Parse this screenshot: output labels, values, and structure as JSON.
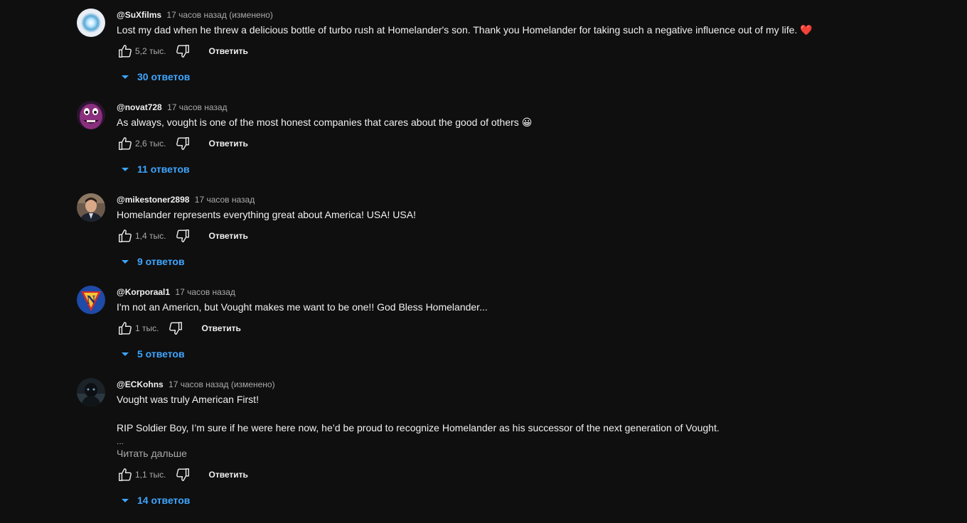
{
  "comments": [
    {
      "author": "@SuXfilms",
      "time": "17 часов назад",
      "edited": "(изменено)",
      "text": "Lost my dad when he threw a delicious bottle of turbo rush at Homelander's son. Thank you Homelander for taking such a negative influence out of my life.",
      "emoji": "❤️",
      "likes": "5,2 тыс.",
      "reply_label": "Ответить",
      "replies_label": "30 ответов",
      "avatar": "glowing-orb-avatar"
    },
    {
      "author": "@novat728",
      "time": "17 часов назад",
      "text": "As always, vought is one of the most honest companies that cares about the good of others",
      "emoji": "😀",
      "likes": "2,6 тыс.",
      "reply_label": "Ответить",
      "replies_label": "11 ответов",
      "avatar": "purple-character-avatar"
    },
    {
      "author": "@mikestoner2898",
      "time": "17 часов назад",
      "text": "Homelander represents everything great about America! USA! USA!",
      "likes": "1,4 тыс.",
      "reply_label": "Ответить",
      "replies_label": "9 ответов",
      "avatar": "man-in-suit-avatar"
    },
    {
      "author": "@Korporaal1",
      "time": "17 часов назад",
      "text": "I'm not an Americn, but Vought makes me want to be one!! God Bless Homelander...",
      "likes": "1 тыс.",
      "reply_label": "Ответить",
      "replies_label": "5 ответов",
      "avatar": "n-shield-logo-avatar"
    },
    {
      "author": "@ECKohns",
      "time": "17 часов назад",
      "edited": "(изменено)",
      "text": "Vought was truly American First!",
      "text2": "RIP Soldier Boy, I’m sure if he were here now, he’d be proud to recognize Homelander as his successor of the next generation of Vought.",
      "ellipsis": "...",
      "read_more": "Читать дальше",
      "likes": "1,1 тыс.",
      "reply_label": "Ответить",
      "replies_label": "14 ответов",
      "avatar": "dark-figure-avatar"
    }
  ],
  "colors": {
    "background": "#0f0f0f",
    "text_primary": "#f1f1f1",
    "text_secondary": "#aaaaaa",
    "link_blue": "#3ea6ff"
  }
}
